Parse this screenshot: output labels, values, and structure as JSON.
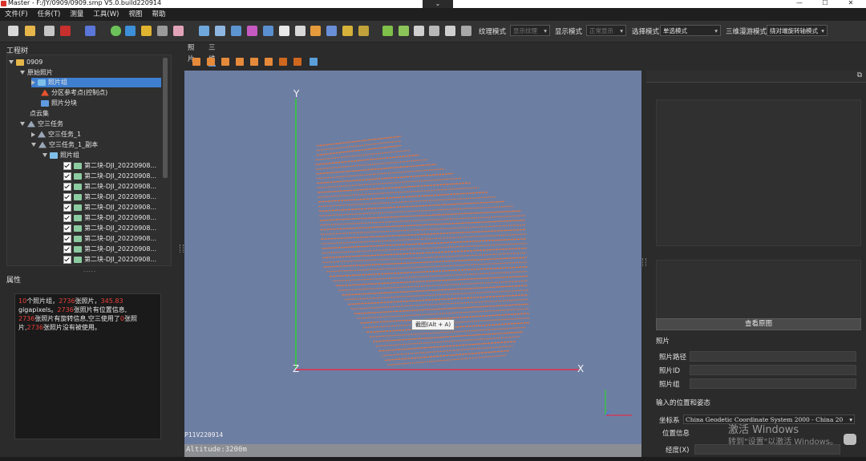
{
  "window": {
    "title": "Master - F:/JY/0909/0909.smp   V5.0.build220914",
    "minimize": "—",
    "maximize": "☐",
    "close": "✕",
    "dropdown_glyph": "⌄"
  },
  "menu": [
    "文件(F)",
    "任务(T)",
    "测量",
    "工具(W)",
    "视图",
    "帮助"
  ],
  "toolbar": {
    "texture_mode_label": "纹理模式",
    "texture_mode_value": "显示纹理",
    "display_mode_label": "显示模式",
    "display_mode_value": "正常显示",
    "select_mode_label": "选择模式",
    "select_mode_value": "单选模式",
    "nav_mode_label": "三维漫游模式",
    "nav_mode_value": "绕对端旋转轴模式"
  },
  "project_tree": {
    "title": "工程树",
    "items": [
      {
        "label": "0909",
        "icon": "folder-icon"
      },
      {
        "label": "原始照片",
        "icon": "none"
      },
      {
        "label": "照片组",
        "icon": "photo-group-icon",
        "selected": true
      },
      {
        "label": "分区参考点(控制点)",
        "icon": "control-point-icon"
      },
      {
        "label": "照片分块",
        "icon": "photo-block-icon"
      },
      {
        "label": "点云集",
        "icon": "none"
      },
      {
        "label": "空三任务",
        "icon": "aerotriangulation-icon"
      },
      {
        "label": "空三任务_1",
        "icon": "aerotriangulation-icon"
      },
      {
        "label": "空三任务_1_副本",
        "icon": "aerotriangulation-icon"
      },
      {
        "label": "照片组",
        "icon": "photo-group-icon"
      }
    ],
    "photos": [
      "第二块-DJI_20220908...",
      "第二块-DJI_20220908...",
      "第二块-DJI_20220908...",
      "第二块-DJI_20220908...",
      "第二块-DJI_20220908...",
      "第二块-DJI_20220908...",
      "第二块-DJI_20220908...",
      "第二块-DJI_20220908...",
      "第二块-DJI_20220908...",
      "第二块-DJI_20220908..."
    ]
  },
  "properties": {
    "title": "属性",
    "line1_num": "10",
    "line1_a": "个照片组，",
    "line1_num2": "2736",
    "line1_b": "张照片，",
    "line1_num3": "345.83",
    "line2": "gigapixels。",
    "line2_num": "2736",
    "line2_b": "张照片有位置信息,",
    "line3_num": "2736",
    "line3_b": "张照片有旋转信息,空三使用了",
    "line3_num2": "0",
    "line3_c": "张照",
    "line4_a": "片,",
    "line4_num": "2736",
    "line4_b": "张照片没有被使用。"
  },
  "view_tabs": [
    "照片",
    "三维"
  ],
  "viewport": {
    "axis_y": "Y",
    "axis_z": "Z",
    "axis_x": "X",
    "tooltip": "截图(Alt + A)",
    "version_label": "P11V220914",
    "altitude": "Altitude:3200m"
  },
  "right_panel": {
    "restore_glyph": "⧉",
    "view_original_button": "查看原图",
    "photo_section": "照片",
    "photo_path_label": "照片路径",
    "photo_id_label": "照片ID",
    "photo_group_label": "照片组",
    "input_pose_label": "输入的位置和姿态",
    "crs_label": "坐标系",
    "crs_value": "China Geodetic Coordinate System 2000 - China 20",
    "position_info_label": "位置信息",
    "longitude_label": "经度(X)"
  },
  "watermark": {
    "line1": "激活 Windows",
    "line2": "转到\"设置\"以激活 Windows。"
  },
  "colors": {
    "flight_lines": "#e8743a",
    "viewport_bg": "#6d7ea3",
    "axis_y": "#2fd02f",
    "axis_x": "#e0304a",
    "selection": "#3f7fd0",
    "highlight_red": "#e8403a"
  }
}
